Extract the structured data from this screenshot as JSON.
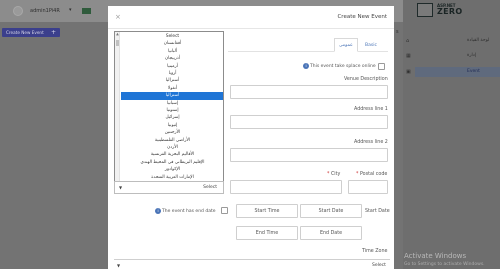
{
  "header": {
    "user_name": "admin1Pi4R",
    "caret": "▾"
  },
  "main": {
    "create_button": "Create New Event",
    "create_button_icon": "plus-icon",
    "column_label": "s"
  },
  "sidebar": {
    "logo_small": "ASP.NET",
    "logo_big": "ZERO",
    "back_icon": "chevron-left-icon",
    "items": [
      {
        "label": "لوحة القيادة",
        "icon": "home-icon"
      },
      {
        "label": "إدارة",
        "icon": "grid-icon"
      },
      {
        "label": "Event",
        "icon": "calendar-icon",
        "active": true
      }
    ]
  },
  "watermark": {
    "title": "Activate Windows",
    "subtitle": "Go to Settings to activate Windows."
  },
  "modal": {
    "title": "Create New Event",
    "close_icon": "close-icon",
    "tabs": {
      "basic": "Basic",
      "general": "عمومی"
    },
    "online_label": "This event take splace online",
    "online_info_icon": "info-icon",
    "venue_label": "Venue Description",
    "address1_label": "Address line 1",
    "address2_label": "Address line 2",
    "city_label": "City",
    "postal_label": "Postal code",
    "country_select_value": "Select",
    "country_options": [
      "Select",
      "أفغانستان",
      "ألبانيا",
      "أذربيجان",
      "أرمينيا",
      "أروبا",
      "أستراليا",
      "أنغولا",
      "أستراليا",
      "إسبانيا",
      "إستونيا",
      "إسرائيل",
      "إثيوبيا",
      "الأرجنتين",
      "الأراضي الفلسطينية",
      "الأردن",
      "الأقاليم البحرية الفرنسية",
      "الإقليم البريطاني في المحيط الهندي",
      "الإكوادور",
      "الإمارات العربية المتحدة"
    ],
    "country_selected_index": 8,
    "end_date_label": "The event has end date",
    "end_date_info_icon": "info-icon",
    "start_date_label": "Start Date",
    "start_date_placeholder": "Start Date",
    "start_time_placeholder": "Start Time",
    "end_date_placeholder": "End Date",
    "end_time_placeholder": "End Time",
    "timezone_label": "Time Zone",
    "timezone_value": "Select"
  }
}
